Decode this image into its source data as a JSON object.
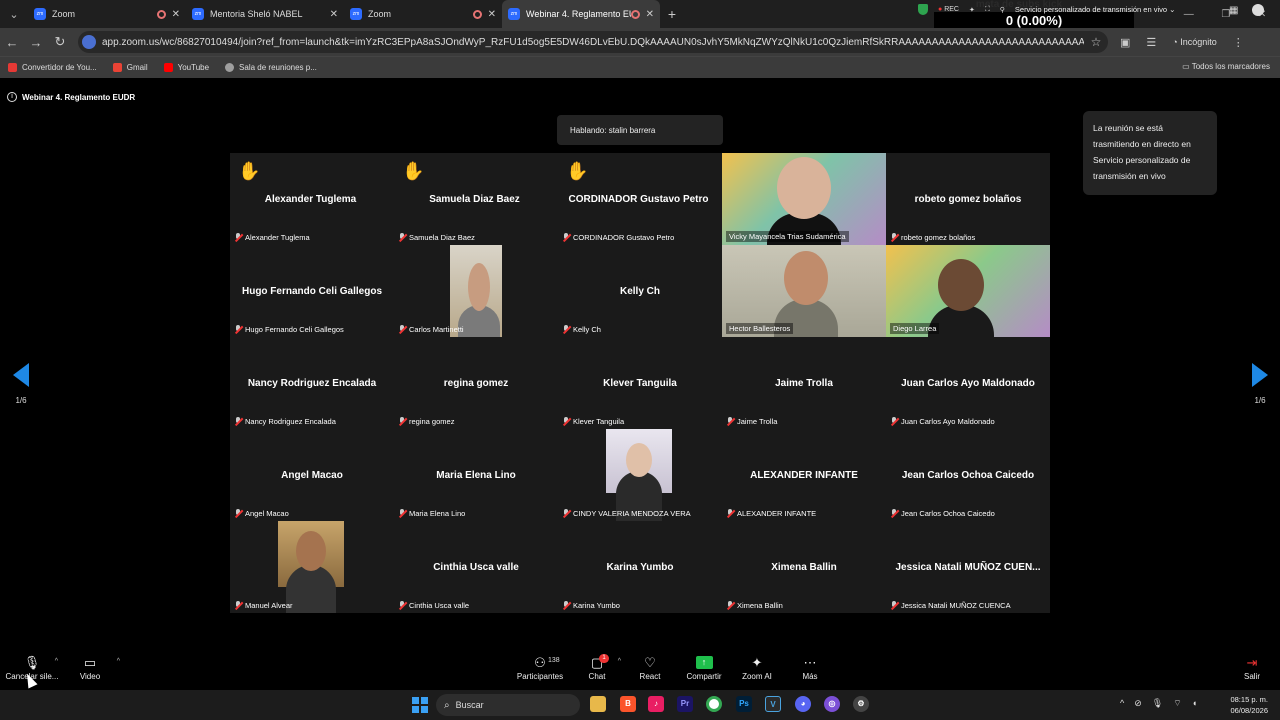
{
  "browser": {
    "tabs": [
      {
        "label": "Zoom",
        "active": false,
        "recording": true
      },
      {
        "label": "Mentoria Sheló NABEL",
        "active": false,
        "recording": false
      },
      {
        "label": "Zoom",
        "active": false,
        "recording": true
      },
      {
        "label": "Webinar 4. Reglamento EU",
        "active": true,
        "recording": true
      }
    ],
    "url": "app.zoom.us/wc/86827010494/join?ref_from=launch&tk=imYzRC3EPpA8aSJOndWyP_RzFU1d5og5E5DW46DLvEbU.DQkAAAAUN0sJvhY5MkNqZWYzQlNkU1c0QzJiemRfSkRRAAAAAAAAAAAAAAAAAAAAAAAAAAAAAAAAAAAAAAAAAAAAAAAAAAAAAAAAAAAA...",
    "incognito_label": "Incógnito",
    "bookmarks": [
      {
        "label": "Convertidor de You...",
        "color": "#e53935"
      },
      {
        "label": "Gmail",
        "color": "#ea4335"
      },
      {
        "label": "YouTube",
        "color": "#ff0000"
      },
      {
        "label": "Sala de reuniones p...",
        "color": "#9e9e9e"
      }
    ],
    "bookmarks_right": "Todos los marcadores"
  },
  "stream_overlay": {
    "meta": "meta de subs kick",
    "percent": "0 (0.00%)"
  },
  "meeting": {
    "title": "Webinar 4. Reglamento EUDR",
    "rec_label": "REC",
    "live_service": "Servicio personalizado de transmisión en vivo",
    "speaking": "Hablando: stalin barrera",
    "tooltip": "La reunión se está trasmitiendo en directo en Servicio personalizado de transmisión en vivo",
    "page": "1/6"
  },
  "participants": [
    {
      "big": "Alexander Tuglema",
      "label": "Alexander Tuglema",
      "hand": true
    },
    {
      "big": "Samuela Diaz Baez",
      "label": "Samuela Diaz Baez",
      "hand": true
    },
    {
      "big": "CORDINADOR Gustavo Petro",
      "label": "CORDINADOR Gustavo Petro",
      "hand": true
    },
    {
      "big": "",
      "label": "Vicky Mayancela Trias Sudamérica",
      "video": "webinar1"
    },
    {
      "big": "robeto gomez bolaños",
      "label": "robeto gomez bolaños"
    },
    {
      "big": "Hugo Fernando Celi Gallegos",
      "label": "Hugo Fernando Celi Gallegos"
    },
    {
      "big": "",
      "label": "Carlos Martinetti",
      "video": "man1"
    },
    {
      "big": "Kelly Ch",
      "label": "Kelly Ch"
    },
    {
      "big": "",
      "label": "Hector Ballesteros",
      "video": "man2",
      "active": true
    },
    {
      "big": "",
      "label": "Diego Larrea",
      "video": "webinar2"
    },
    {
      "big": "Nancy Rodriguez Encalada",
      "label": "Nancy Rodriguez Encalada"
    },
    {
      "big": "regina gomez",
      "label": "regina gomez"
    },
    {
      "big": "Klever Tanguila",
      "label": "Klever Tanguila"
    },
    {
      "big": "Jaime Trolla",
      "label": "Jaime Trolla"
    },
    {
      "big": "Juan Carlos Ayo Maldonado",
      "label": "Juan Carlos Ayo Maldonado"
    },
    {
      "big": "Angel Macao",
      "label": "Angel Macao"
    },
    {
      "big": "Maria Elena Lino",
      "label": "Maria Elena Lino"
    },
    {
      "big": "",
      "label": "CINDY VALERIA MENDOZA VERA",
      "video": "woman1"
    },
    {
      "big": "ALEXANDER INFANTE",
      "label": "ALEXANDER INFANTE"
    },
    {
      "big": "Jean Carlos Ochoa Caicedo",
      "label": "Jean Carlos Ochoa Caicedo"
    },
    {
      "big": "",
      "label": "Manuel Alvear",
      "video": "man3"
    },
    {
      "big": "Cinthia Usca valle",
      "label": "Cinthia Usca valle"
    },
    {
      "big": "Karina Yumbo",
      "label": "Karina Yumbo"
    },
    {
      "big": "Ximena Ballin",
      "label": "Ximena Ballin"
    },
    {
      "big": "Jessica Natali MUÑOZ CUEN...",
      "label": "Jessica Natali MUÑOZ CUENCA"
    }
  ],
  "toolbar": {
    "mute_label": "Cancelar sile...",
    "video_label": "Video",
    "participants_label": "Participantes",
    "participants_count": "138",
    "chat_label": "Chat",
    "chat_badge": "1",
    "react_label": "React",
    "share_label": "Compartir",
    "ai_label": "Zoom AI",
    "more_label": "Más",
    "leave_label": "Salir"
  },
  "taskbar": {
    "search_placeholder": "Buscar",
    "time": "08:15 p. m.",
    "date": "06/08/2026"
  }
}
